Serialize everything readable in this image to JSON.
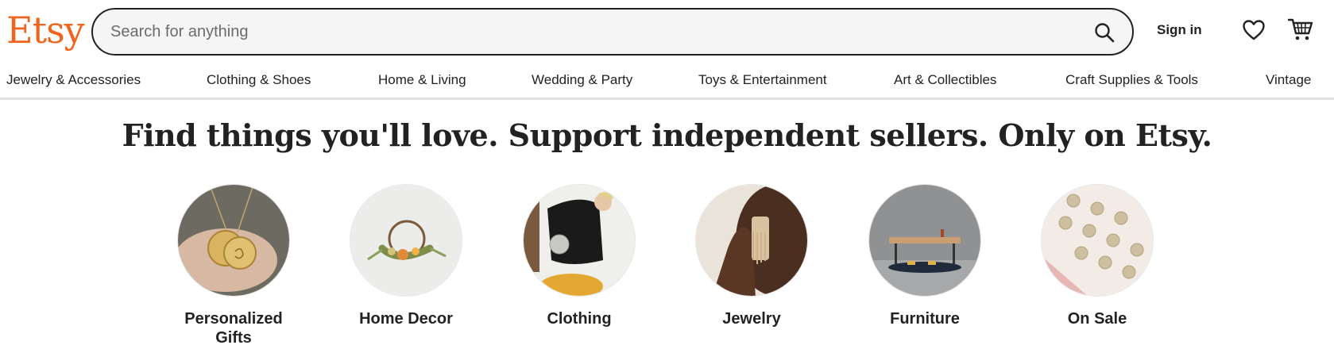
{
  "header": {
    "logo": "Etsy",
    "search_placeholder": "Search for anything",
    "search_icon": "search-icon",
    "sign_in": "Sign in",
    "favorites_icon": "heart-icon",
    "cart_icon": "cart-icon",
    "brand_color": "#F1641E"
  },
  "categories": [
    "Jewelry & Accessories",
    "Clothing & Shoes",
    "Home & Living",
    "Wedding & Party",
    "Toys & Entertainment",
    "Art & Collectibles",
    "Craft Supplies & Tools",
    "Vintage"
  ],
  "hero": {
    "tagline": "Find things you'll love. Support independent sellers. Only on Etsy."
  },
  "featured": [
    {
      "label": "Personalized\nGifts",
      "image": "gold-pendant-necklace-photo"
    },
    {
      "label": "Home Decor",
      "image": "dried-flower-wreath-photo"
    },
    {
      "label": "Clothing",
      "image": "woman-black-dress-photo"
    },
    {
      "label": "Jewelry",
      "image": "woman-earring-photo"
    },
    {
      "label": "Furniture",
      "image": "wooden-side-table-photo"
    },
    {
      "label": "On Sale",
      "image": "coin-pendants-photo"
    }
  ]
}
